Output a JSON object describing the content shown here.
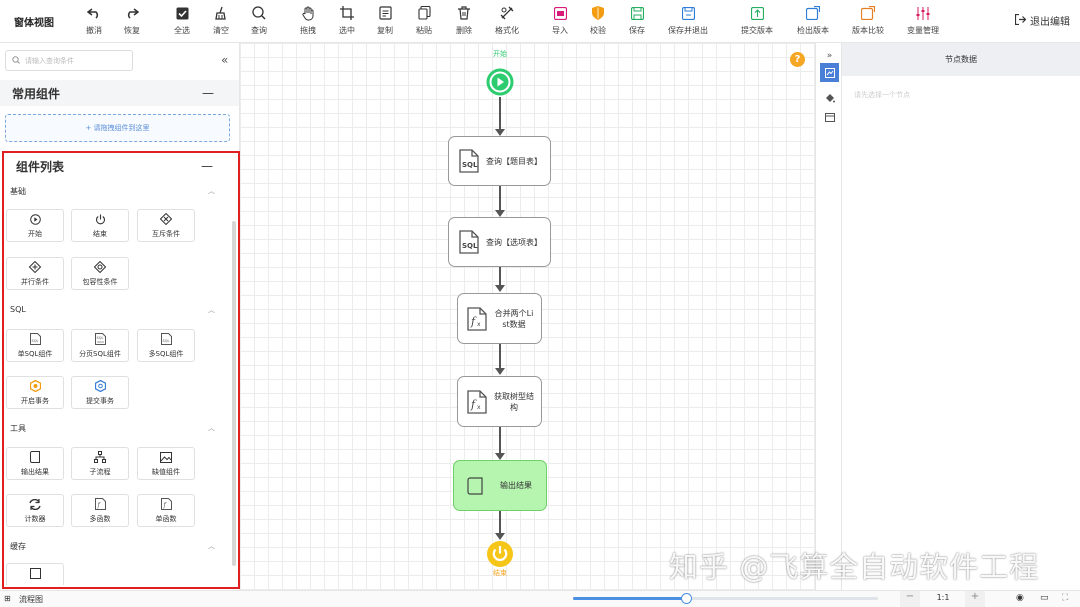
{
  "app": {
    "title": "窗体视图",
    "exit_label": "退出编辑"
  },
  "toolbar": [
    {
      "label": "撤消",
      "icon": "undo-icon"
    },
    {
      "label": "恢复",
      "icon": "redo-icon"
    },
    {
      "label": "全选",
      "icon": "select-all-icon"
    },
    {
      "label": "清空",
      "icon": "clear-icon"
    },
    {
      "label": "查询",
      "icon": "search-icon"
    },
    {
      "label": "拖拽",
      "icon": "hand-icon"
    },
    {
      "label": "选中",
      "icon": "crop-icon"
    },
    {
      "label": "复制",
      "icon": "copy-icon"
    },
    {
      "label": "粘贴",
      "icon": "paste-icon"
    },
    {
      "label": "删除",
      "icon": "trash-icon"
    },
    {
      "label": "格式化",
      "icon": "format-icon"
    },
    {
      "label": "导入",
      "icon": "import-icon"
    },
    {
      "label": "校验",
      "icon": "shield-icon"
    },
    {
      "label": "保存",
      "icon": "save-icon"
    },
    {
      "label": "保存并退出",
      "icon": "save-exit-icon"
    },
    {
      "label": "提交版本",
      "icon": "commit-icon"
    },
    {
      "label": "检出版本",
      "icon": "checkout-icon"
    },
    {
      "label": "版本比较",
      "icon": "compare-icon"
    },
    {
      "label": "变量管理",
      "icon": "variables-icon"
    }
  ],
  "left": {
    "search_placeholder": "请输入查询条件",
    "common_title": "常用组件",
    "dropzone_text": "+ 请拖拽组件到这里",
    "list_title": "组件列表",
    "groups": [
      {
        "name": "基础",
        "items": [
          "开始",
          "结束",
          "互斥条件",
          "并行条件",
          "包容性条件"
        ]
      },
      {
        "name": "SQL",
        "items": [
          "单SQL组件",
          "分页SQL组件",
          "多SQL组件",
          "开启事务",
          "提交事务"
        ]
      },
      {
        "name": "工具",
        "items": [
          "输出结果",
          "子流程",
          "缺值组件",
          "计数器",
          "多函数",
          "单函数"
        ]
      },
      {
        "name": "缓存",
        "items": [
          ""
        ]
      }
    ]
  },
  "flow": {
    "start_label": "开始",
    "end_label": "结束",
    "nodes": [
      {
        "label": "查询【题目表】",
        "icon": "sql-icon"
      },
      {
        "label": "查询【选项表】",
        "icon": "sql-icon"
      },
      {
        "label": "合并两个List数据",
        "icon": "function-icon"
      },
      {
        "label": "获取树型结构",
        "icon": "function-icon"
      },
      {
        "label": "输出结果",
        "icon": "output-icon"
      }
    ]
  },
  "right": {
    "panel_title": "节点数据",
    "hint": "请先选择一个节点"
  },
  "status": {
    "tab_label": "流程图",
    "zoom": "1:1",
    "zoom_fraction": 0.37
  },
  "watermark": "知乎 @飞算全自动软件工程",
  "colors": {
    "accent": "#4a90e2",
    "start": "#2ecc71",
    "end": "#f5a623",
    "output_fill": "#b5f5b0",
    "highlight_border": "#e02020"
  }
}
